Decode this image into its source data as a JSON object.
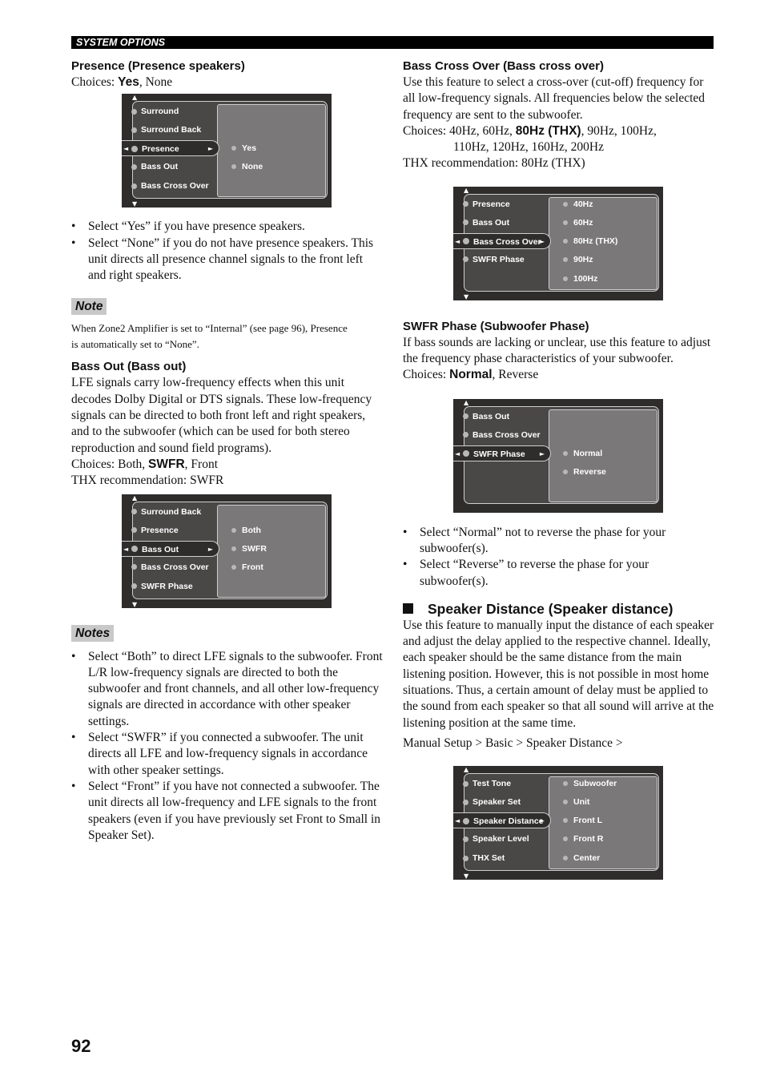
{
  "header": {
    "section": "SYSTEM OPTIONS"
  },
  "page_number": "92",
  "left": {
    "presence": {
      "title": "Presence (Presence speakers)",
      "choices_prefix": "Choices: ",
      "choices_default": "Yes",
      "choices_rest": ", None",
      "osd": {
        "menu": [
          "Surround",
          "Surround Back",
          "Presence",
          "Bass Out",
          "Bass Cross Over"
        ],
        "selected_index": 2,
        "options": [
          "Yes",
          "None"
        ],
        "options_start_row": 2
      },
      "bullets": [
        "Select “Yes” if you have presence speakers.",
        "Select “None” if you do not have presence speakers. This unit directs all presence channel signals to the front left and right speakers."
      ],
      "note_label": "Note",
      "note_text": "When Zone2 Amplifier is set to “Internal” (see page 96), Presence is automatically set to “None”."
    },
    "bass_out": {
      "title": "Bass Out (Bass out)",
      "body": "LFE signals carry low-frequency effects when this unit decodes Dolby Digital or DTS signals. These low-frequency signals can be directed to both front left and right speakers, and to the subwoofer (which can be used for both stereo reproduction and sound field programs).",
      "choices_prefix": "Choices: Both, ",
      "choices_default": "SWFR",
      "choices_rest": ", Front",
      "thx": "THX recommendation: SWFR",
      "osd": {
        "menu": [
          "Surround Back",
          "Presence",
          "Bass Out",
          "Bass Cross Over",
          "SWFR Phase"
        ],
        "selected_index": 2,
        "options": [
          "Both",
          "SWFR",
          "Front"
        ],
        "options_start_row": 1
      },
      "notes_label": "Notes",
      "notes": [
        "Select “Both” to direct LFE signals to the subwoofer. Front L/R low-frequency signals are directed to both the subwoofer and front channels, and all other low-frequency signals are directed in accordance with other speaker settings.",
        "Select “SWFR” if you connected a subwoofer. The unit directs all LFE and low-frequency signals in accordance with other speaker settings.",
        "Select “Front” if you have not connected a subwoofer. The unit directs all low-frequency and LFE signals to the front speakers (even if you have previously set Front to Small in Speaker Set)."
      ]
    }
  },
  "right": {
    "bass_cross_over": {
      "title": "Bass Cross Over (Bass cross over)",
      "body": "Use this feature to select a cross-over (cut-off) frequency for all low-frequency signals. All frequencies below the selected frequency are sent to the subwoofer.",
      "choices_prefix": "Choices: 40Hz, 60Hz, ",
      "choices_default": "80Hz (THX)",
      "choices_rest": ", 90Hz, 100Hz,",
      "choices_line2": "110Hz, 120Hz, 160Hz, 200Hz",
      "thx": "THX recommendation: 80Hz (THX)",
      "osd": {
        "menu": [
          "Presence",
          "Bass Out",
          "Bass Cross Over",
          "SWFR Phase",
          ""
        ],
        "selected_index": 2,
        "options": [
          "40Hz",
          "60Hz",
          "80Hz (THX)",
          "90Hz",
          "100Hz"
        ],
        "options_start_row": 0
      }
    },
    "swfr_phase": {
      "title": "SWFR Phase (Subwoofer Phase)",
      "body": "If bass sounds are lacking or unclear, use this feature to adjust the frequency phase characteristics of your subwoofer.",
      "choices_prefix": "Choices: ",
      "choices_default": "Normal",
      "choices_rest": ", Reverse",
      "osd": {
        "menu": [
          "Bass Out",
          "Bass Cross Over",
          "SWFR Phase",
          "",
          ""
        ],
        "selected_index": 2,
        "options": [
          "Normal",
          "Reverse"
        ],
        "options_start_row": 2
      },
      "bullets": [
        "Select “Normal” not to reverse the phase for your subwoofer(s).",
        "Select “Reverse” to reverse the phase for your subwoofer(s)."
      ]
    },
    "speaker_distance": {
      "title": "Speaker Distance (Speaker distance)",
      "body": "Use this feature to manually input the distance of each speaker and adjust the delay applied to the respective channel. Ideally, each speaker should be the same distance from the main listening position. However, this is not possible in most home situations. Thus, a certain amount of delay must be applied to the sound from each speaker so that all sound will arrive at the listening position at the same time.",
      "path": "Manual Setup > Basic > Speaker Distance >",
      "osd": {
        "menu": [
          "Test Tone",
          "Speaker Set",
          "Speaker Distance",
          "Speaker Level",
          "THX Set"
        ],
        "selected_index": 2,
        "options": [
          "Subwoofer",
          "Unit",
          "Front L",
          "Front R",
          "Center"
        ],
        "options_start_row": 0
      }
    }
  }
}
